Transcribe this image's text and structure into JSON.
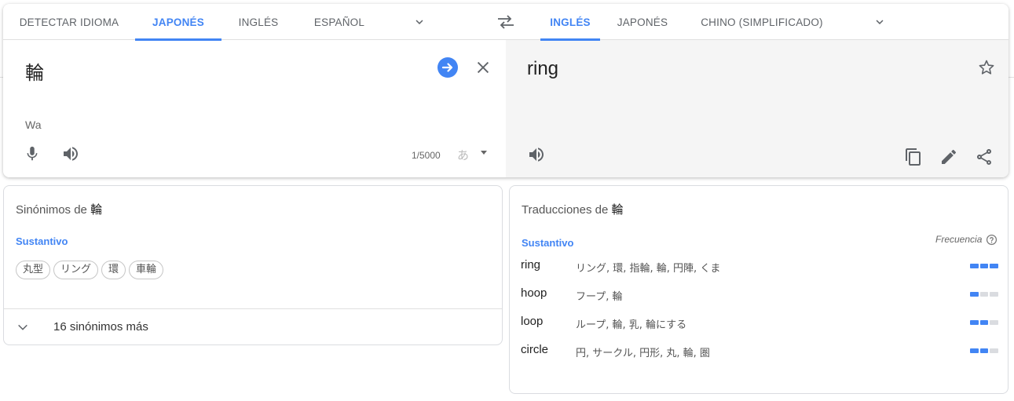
{
  "source_tabs": [
    {
      "label": "DETECTAR IDIOMA",
      "active": false
    },
    {
      "label": "JAPONÉS",
      "active": true
    },
    {
      "label": "INGLÉS",
      "active": false
    },
    {
      "label": "ESPAÑOL",
      "active": false
    }
  ],
  "target_tabs": [
    {
      "label": "INGLÉS",
      "active": true
    },
    {
      "label": "JAPONÉS",
      "active": false
    },
    {
      "label": "CHINO (SIMPLIFICADO)",
      "active": false
    }
  ],
  "source": {
    "text": "輪",
    "romanization": "Wa",
    "char_count": "1/5000",
    "ime_label": "あ"
  },
  "target": {
    "text": "ring"
  },
  "synonyms": {
    "title_prefix": "Sinónimos de",
    "word": "輪",
    "pos": "Sustantivo",
    "chips": [
      "丸型",
      "リング",
      "環",
      "車輪"
    ],
    "more_label": "16 sinónimos más"
  },
  "translations": {
    "title_prefix": "Traducciones de",
    "word": "輪",
    "pos": "Sustantivo",
    "frequency_label": "Frecuencia",
    "rows": [
      {
        "word": "ring",
        "back": "リング, 環, 指輪, 輪, 円陣, くま",
        "frequency": 3
      },
      {
        "word": "hoop",
        "back": "フープ, 輪",
        "frequency": 1
      },
      {
        "word": "loop",
        "back": "ループ, 輪, 乳, 輪にする",
        "frequency": 2
      },
      {
        "word": "circle",
        "back": "円, サークル, 円形, 丸, 輪, 圏",
        "frequency": 2
      }
    ]
  },
  "colors": {
    "accent": "#4285f4",
    "icon": "#5f6368",
    "target_bg": "#f5f5f5"
  }
}
